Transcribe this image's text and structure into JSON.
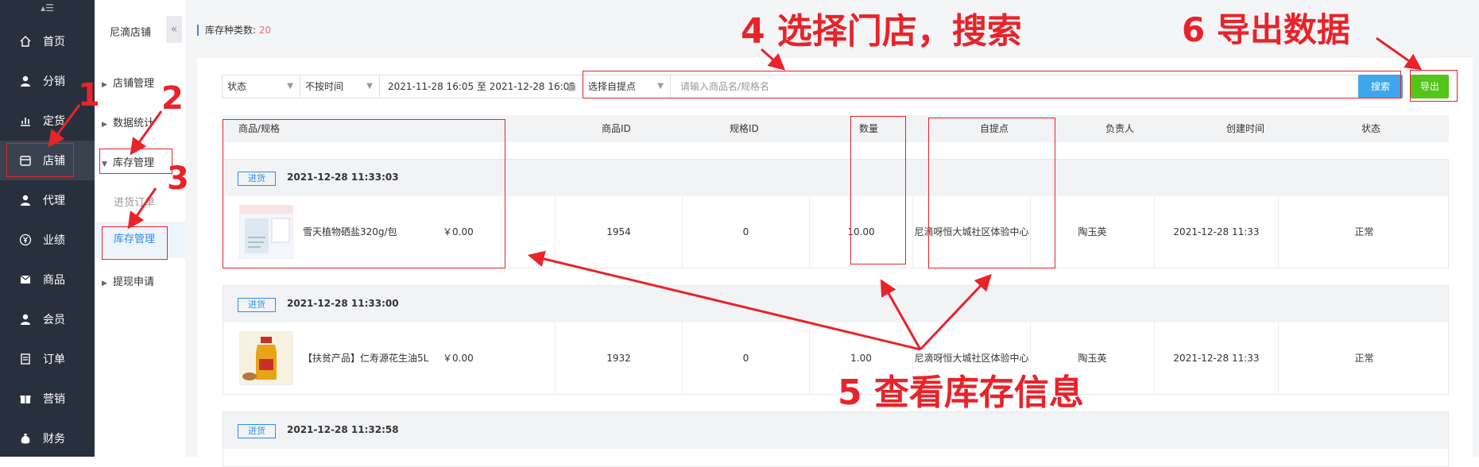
{
  "nav": {
    "toggle_icon": "menu-toggle-icon",
    "items": [
      {
        "label": "首页",
        "icon": "home-icon"
      },
      {
        "label": "分销",
        "icon": "user-icon"
      },
      {
        "label": "定货",
        "icon": "chart-icon"
      },
      {
        "label": "店铺",
        "icon": "store-icon"
      },
      {
        "label": "代理",
        "icon": "user-icon"
      },
      {
        "label": "业绩",
        "icon": "yen-icon"
      },
      {
        "label": "商品",
        "icon": "mail-icon"
      },
      {
        "label": "会员",
        "icon": "user-icon"
      },
      {
        "label": "订单",
        "icon": "document-icon"
      },
      {
        "label": "营销",
        "icon": "gift-icon"
      },
      {
        "label": "财务",
        "icon": "money-bag-icon"
      }
    ]
  },
  "submenu": {
    "title": "尼滴店铺",
    "collapse_icon": "«",
    "groups": [
      {
        "label": "店铺管理"
      },
      {
        "label": "数据统计"
      },
      {
        "label": "库存管理",
        "children": [
          "进货订单",
          "库存管理"
        ]
      },
      {
        "label": "提现申请"
      }
    ]
  },
  "stat": {
    "label": "库存种类数: ",
    "value": "20"
  },
  "filters": {
    "status": "状态",
    "time_type": "不按时间",
    "date_range": "2021-11-28 16:05 至 2021-12-28 16:05",
    "pickup": "选择自提点",
    "search_placeholder": "请输入商品名/规格名",
    "search_label": "搜索",
    "export_label": "导出"
  },
  "table": {
    "headers": [
      "商品/规格",
      "商品ID",
      "规格ID",
      "数量",
      "自提点",
      "负责人",
      "创建时间",
      "状态"
    ],
    "groups": [
      {
        "tag": "进货",
        "time": "2021-12-28  11:33:03",
        "name": "雪天植物硒盐320g/包",
        "price": "￥0.00",
        "product_id": "1954",
        "spec_id": "0",
        "qty": "10.00",
        "pickup": "尼滴呀恒大城社区体验中心",
        "owner": "陶玉英",
        "created": "2021-12-28 11:33",
        "status": "正常"
      },
      {
        "tag": "进货",
        "time": "2021-12-28  11:33:00",
        "name": "【扶贫产品】仁寿源花生油5L",
        "price": "￥0.00",
        "product_id": "1932",
        "spec_id": "0",
        "qty": "1.00",
        "pickup": "尼滴呀恒大城社区体验中心",
        "owner": "陶玉英",
        "created": "2021-12-28 11:33",
        "status": "正常"
      },
      {
        "tag": "进货",
        "time": "2021-12-28  11:32:58"
      }
    ]
  },
  "annotations": {
    "n1": "1",
    "n2": "2",
    "n3": "3",
    "n4": "4 选择门店，搜索",
    "n5": "5 查看库存信息",
    "n6": "6 导出数据"
  },
  "colors": {
    "nav_bg": "#28303d",
    "accent": "#2d8cf0",
    "search": "#3ea6ec",
    "export": "#52c41a",
    "annotation": "#e8232a"
  }
}
